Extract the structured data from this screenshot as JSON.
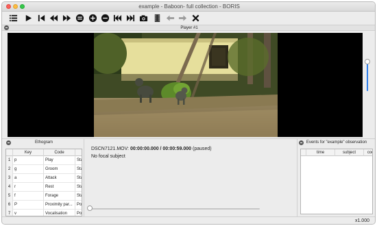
{
  "window": {
    "title": "example - Baboon- full collection - BORIS"
  },
  "toolbar": {
    "buttons": [
      {
        "name": "menu-icon"
      },
      {
        "name": "play-icon"
      },
      {
        "name": "skip-start-icon"
      },
      {
        "name": "rewind-icon"
      },
      {
        "name": "fast-forward-icon"
      },
      {
        "name": "speed-down-icon"
      },
      {
        "name": "speed-up-icon"
      },
      {
        "name": "speed-reset-icon"
      },
      {
        "name": "previous-media-icon"
      },
      {
        "name": "next-media-icon"
      },
      {
        "name": "camera-icon"
      },
      {
        "name": "frame-icon"
      },
      {
        "name": "arrow-left-icon"
      },
      {
        "name": "arrow-right-icon"
      },
      {
        "name": "close-icon"
      }
    ]
  },
  "player": {
    "title": "Player #1"
  },
  "ethogram": {
    "title": "Ethogram",
    "columns": [
      "",
      "Key",
      "Code",
      "Sta"
    ],
    "rows": [
      {
        "num": "1",
        "key": "p",
        "code": "Play",
        "type": "State"
      },
      {
        "num": "2",
        "key": "g",
        "code": "Groom",
        "type": "State"
      },
      {
        "num": "3",
        "key": "a",
        "code": "Attack",
        "type": "State"
      },
      {
        "num": "4",
        "key": "r",
        "code": "Rest",
        "type": "State"
      },
      {
        "num": "5",
        "key": "f",
        "code": "Forage",
        "type": "State"
      },
      {
        "num": "6",
        "key": "P",
        "code": "Proximity par...",
        "type": "Point"
      },
      {
        "num": "7",
        "key": "v",
        "code": "Vocalisation",
        "type": "Point"
      }
    ]
  },
  "media": {
    "filename": "DSCN7121.MOV:",
    "position": "00:00:00.000 / 00:00:59.000",
    "status": "(paused)",
    "focal_subject": "No focal subject"
  },
  "events": {
    "title": "Events for \"example\" observation",
    "columns": [
      "time",
      "subject",
      "coc"
    ]
  },
  "status": {
    "speed": "x1.000"
  },
  "colors": {
    "accent": "#2b7de9",
    "title_bar": "#e0e0e0",
    "panel": "#ececec"
  }
}
